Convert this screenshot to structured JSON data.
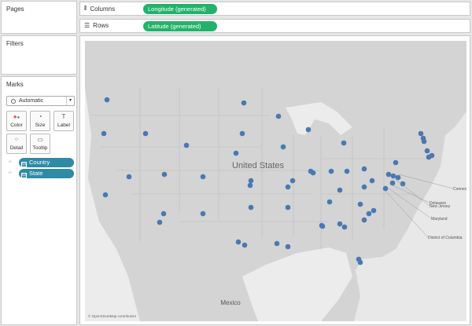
{
  "pages": {
    "title": "Pages"
  },
  "filters": {
    "title": "Filters"
  },
  "marks": {
    "title": "Marks",
    "mark_type": "Automatic",
    "buttons": {
      "color": "Color",
      "size": "Size",
      "label": "Label",
      "detail": "Detail",
      "tooltip": "Tooltip"
    },
    "fields": {
      "country": "Country",
      "state": "State"
    }
  },
  "columns": {
    "label": "Columns",
    "pill": "Longitude (generated)"
  },
  "rows": {
    "label": "Rows",
    "pill": "Latitude (generated)"
  },
  "colors": {
    "pill_green": "#22b26a",
    "pill_blue": "#2f8aa6",
    "dot": "#4a78b0"
  },
  "map": {
    "country_label": "United States",
    "mexico_label": "Mexico",
    "copyright": "© OpenStreetMap contributors",
    "callouts": [
      "Delaware",
      "New Jersey",
      "Connecticut",
      "Maryland",
      "District of Columbia"
    ]
  }
}
